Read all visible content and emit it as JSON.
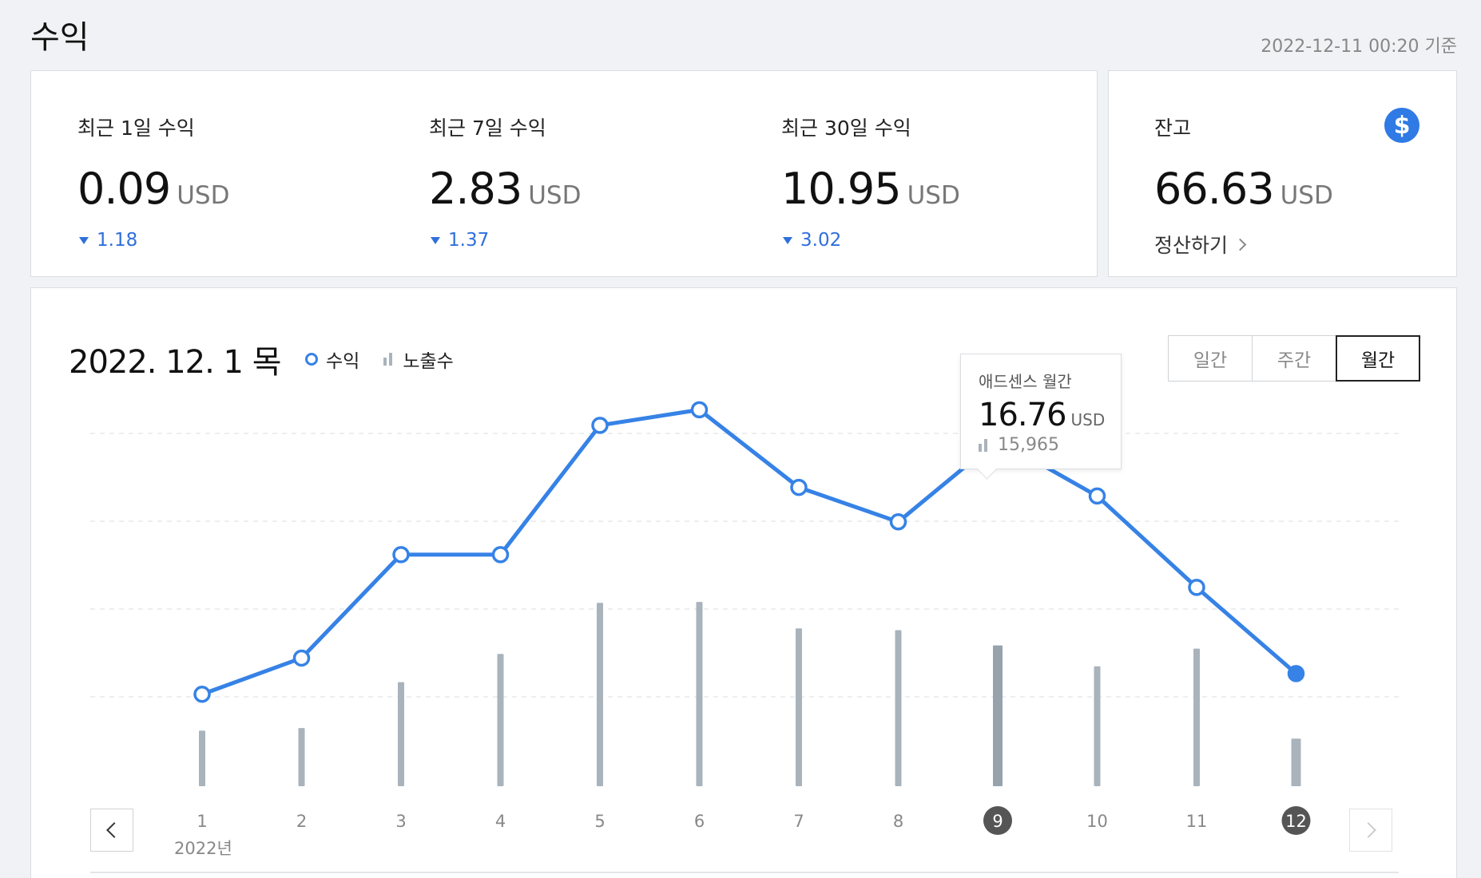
{
  "header": {
    "title": "수익",
    "as_of": "2022-12-11 00:20 기준"
  },
  "summary": [
    {
      "label": "최근 1일 수익",
      "value": "0.09",
      "unit": "USD",
      "delta": "1.18",
      "direction": "down"
    },
    {
      "label": "최근 7일 수익",
      "value": "2.83",
      "unit": "USD",
      "delta": "1.37",
      "direction": "down"
    },
    {
      "label": "최근 30일 수익",
      "value": "10.95",
      "unit": "USD",
      "delta": "3.02",
      "direction": "down"
    }
  ],
  "balance": {
    "label": "잔고",
    "value": "66.63",
    "unit": "USD",
    "settle_label": "정산하기",
    "icon": "dollar-icon"
  },
  "chart_header": {
    "date": "2022. 12. 1 목",
    "legend_revenue": "수익",
    "legend_impressions": "노출수"
  },
  "period_tabs": [
    {
      "label": "일간",
      "active": false
    },
    {
      "label": "주간",
      "active": false
    },
    {
      "label": "월간",
      "active": true
    }
  ],
  "tooltip": {
    "label": "애드센스 월간",
    "value": "16.76",
    "unit": "USD",
    "impressions": "15,965"
  },
  "year_label": "2022년",
  "colors": {
    "line": "#3682e6",
    "bars": "#a9b3bc",
    "highlight_bar": "#97a2ac",
    "delta": "#2f6fdc"
  },
  "chart_data": {
    "type": "line",
    "x": [
      "1",
      "2",
      "3",
      "4",
      "5",
      "6",
      "7",
      "8",
      "9",
      "10",
      "11",
      "12"
    ],
    "series": [
      {
        "name": "수익",
        "type": "line",
        "values": [
          2.0,
          4.1,
          10.1,
          10.1,
          17.6,
          18.5,
          14.0,
          12.0,
          16.76,
          13.5,
          8.2,
          3.2
        ]
      },
      {
        "name": "노출수",
        "type": "bar",
        "values": [
          6300,
          6600,
          11800,
          15000,
          20800,
          20900,
          17900,
          17700,
          15965,
          13600,
          15600,
          5400
        ]
      }
    ],
    "highlighted_indices": [
      8,
      11
    ],
    "grid": true
  }
}
